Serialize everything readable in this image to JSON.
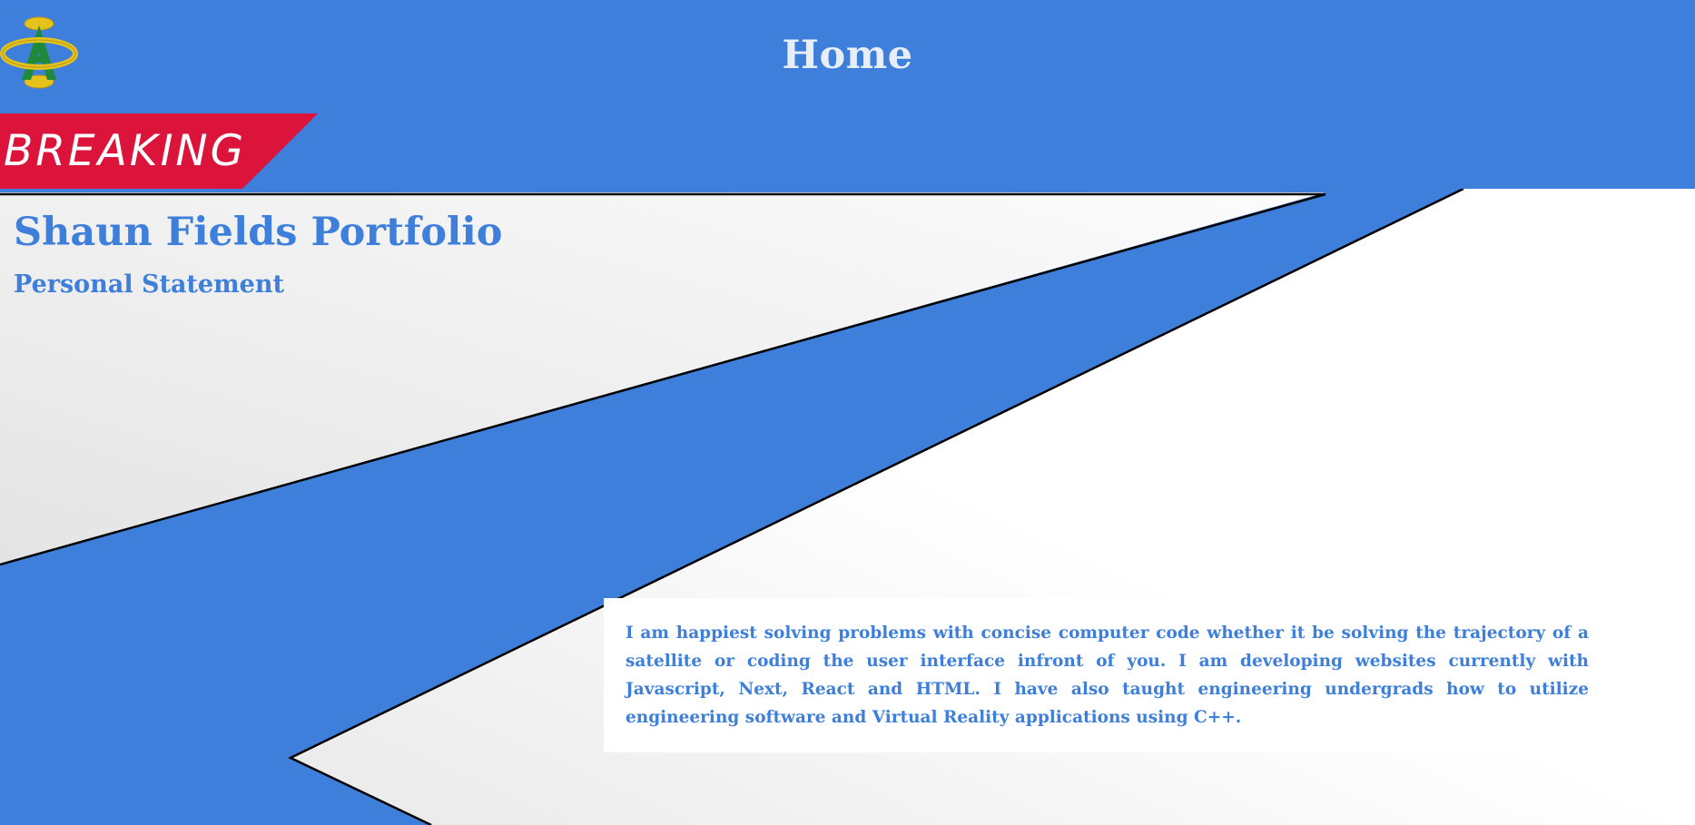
{
  "header": {
    "logo_icon": "gold-ring-letter-a-logo-icon",
    "nav_title": "Home",
    "breaking_label": "BREAKING"
  },
  "main": {
    "title": "Shaun Fields Portfolio",
    "section_heading": "Personal Statement",
    "statement": "I am happiest solving problems with concise computer code whether it be solving the trajectory of a satellite or coding the user interface infront of you. I am developing websites currently with Javascript, Next, React and HTML. I have also taught engineering undergrads how to utilize engineering software and Virtual Reality applications using C++."
  },
  "colors": {
    "primary_blue": "#3d7fda",
    "breaking_red": "#dc143c",
    "heading_light": "#e8eef8",
    "logo_gold": "#e6c21c",
    "logo_green": "#1f8a3a"
  }
}
